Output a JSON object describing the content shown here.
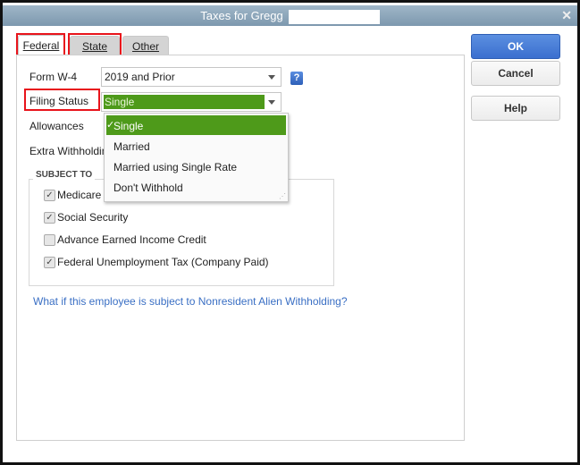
{
  "window": {
    "title": "Taxes for Gregg",
    "close_icon": "close-icon"
  },
  "tabs": [
    {
      "label": "Federal",
      "selected": true
    },
    {
      "label": "State",
      "selected": false
    },
    {
      "label": "Other",
      "selected": false
    }
  ],
  "buttons": {
    "ok": "OK",
    "cancel": "Cancel",
    "help": "Help"
  },
  "form": {
    "w4_label": "Form W-4",
    "w4_value": "2019 and Prior",
    "help_icon": "?",
    "filing_label": "Filing Status",
    "filing_value": "Single",
    "allowances_label": "Allowances",
    "extra_label": "Extra Withholding"
  },
  "dropdown": {
    "options": [
      "Single",
      "Married",
      "Married using Single Rate",
      "Don't Withhold"
    ],
    "selected": "Single",
    "check": "✓"
  },
  "subject_to": {
    "title": "SUBJECT TO",
    "items": [
      {
        "label": "Medicare",
        "checked": true
      },
      {
        "label": "Social Security",
        "checked": true
      },
      {
        "label": "Advance Earned Income Credit",
        "checked": false
      },
      {
        "label": "Federal Unemployment Tax (Company Paid)",
        "checked": true
      }
    ]
  },
  "link": "What if this employee is subject to Nonresident Alien Withholding?",
  "colors": {
    "accent_green": "#4e9a1a",
    "ok_blue": "#3b6fcf",
    "highlight_red": "#e8141b",
    "link": "#3a6fc4"
  }
}
